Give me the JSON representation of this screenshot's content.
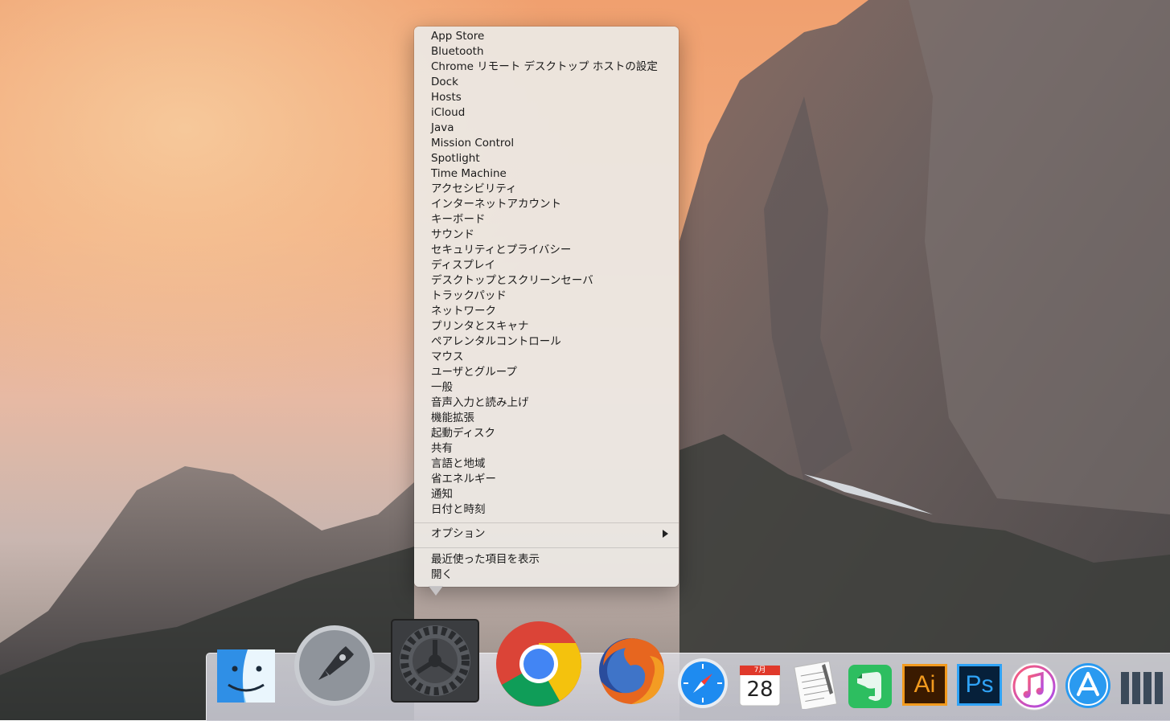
{
  "menu": {
    "items": [
      "App Store",
      "Bluetooth",
      "Chrome リモート デスクトップ ホストの設定",
      "Dock",
      "Hosts",
      "iCloud",
      "Java",
      "Mission Control",
      "Spotlight",
      "Time Machine",
      "アクセシビリティ",
      "インターネットアカウント",
      "キーボード",
      "サウンド",
      "セキュリティとプライバシー",
      "ディスプレイ",
      "デスクトップとスクリーンセーバ",
      "トラックパッド",
      "ネットワーク",
      "プリンタとスキャナ",
      "ペアレンタルコントロール",
      "マウス",
      "ユーザとグループ",
      "一般",
      "音声入力と読み上げ",
      "機能拡張",
      "起動ディスク",
      "共有",
      "言語と地域",
      "省エネルギー",
      "通知",
      "日付と時刻"
    ],
    "options_label": "オプション",
    "show_recent_label": "最近使った項目を表示",
    "open_label": "開く"
  },
  "dock": {
    "calendar_month": "7月",
    "calendar_day": "28",
    "illustrator_label": "Ai",
    "photoshop_label": "Ps",
    "icons": [
      "finder-icon",
      "launchpad-icon",
      "system-preferences-icon",
      "chrome-icon",
      "firefox-icon",
      "safari-icon",
      "calendar-icon",
      "textedit-icon",
      "evernote-icon",
      "illustrator-icon",
      "photoshop-icon",
      "itunes-icon",
      "app-store-icon",
      "stacks-icon"
    ]
  }
}
